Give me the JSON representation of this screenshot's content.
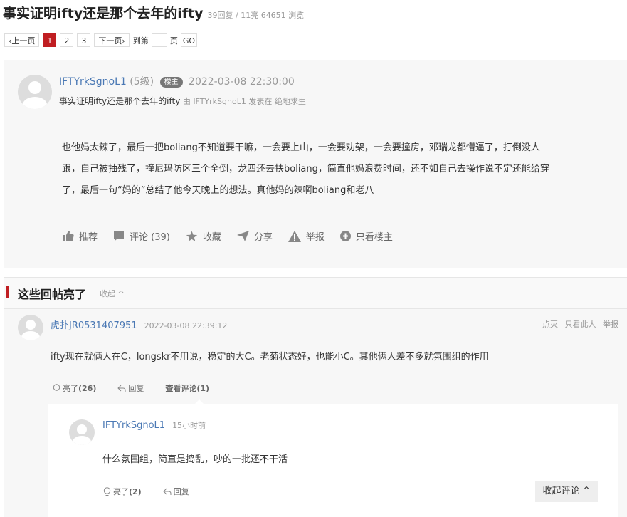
{
  "thread": {
    "title": "事实证明ifty还是那个去年的ifty",
    "stats": "39回复 / 11亮 64651 浏览"
  },
  "pager": {
    "prev": "‹上一页",
    "pages": [
      "1",
      "2",
      "3"
    ],
    "next": "下一页›",
    "goto_prefix": "到第",
    "goto_suffix": "页",
    "go": "GO"
  },
  "post": {
    "username": "IFTYrkSgnoL1",
    "level": "(5级)",
    "badge": "楼主",
    "time": "2022-03-08 22:30:00",
    "subject": "事实证明ifty还是那个去年的ifty",
    "by_label": "由",
    "by_user": "IFTYrkSgnoL1",
    "posted_in_label": "发表在",
    "forum": "绝地求生",
    "content_lines": [
      "也他妈太辣了，最后一把boliang不知道要干嘛，一会要上山，一会要劝架，一会要撞房，邓瑞龙都懵逼了，打倒没人",
      "跟，自己被抽残了，撞尼玛防区三个全倒，龙四还去扶boliang，简直他妈浪费时间，还不如自己去操作说不定还能给穿",
      "了，最后一句“妈的”总结了他今天晚上的想法。真他妈的辣啊boliang和老八"
    ],
    "actions": {
      "recommend": "推荐",
      "comment": "评论 (39)",
      "favorite": "收藏",
      "share": "分享",
      "report": "举报",
      "only_op": "只看楼主"
    }
  },
  "highlights": {
    "title": "这些回帖亮了",
    "collapse": "收起 ^",
    "reply": {
      "username": "虎扑JR0531407951",
      "time": "2022-03-08 22:39:12",
      "links": [
        "点灭",
        "只看此人",
        "举报"
      ],
      "text": "ifty现在就俩人在C，longskr不用说，稳定的大C。老菊状态好，也能小C。其他俩人差不多就氛围组的作用",
      "light": "亮了",
      "light_count": "(26)",
      "reply_label": "回复",
      "view_comments": "查看评论(1)"
    },
    "sub_reply": {
      "username": "IFTYrkSgnoL1",
      "time": "15小时前",
      "text": "什么氛围组，简直是捣乱，吵的一批还不干活",
      "light": "亮了",
      "light_count": "(2)",
      "reply_label": "回复",
      "collapse_comments": "收起评论 ^"
    }
  },
  "colors": {
    "accent_red": "#c01e22",
    "link_blue": "#4a78b4",
    "panel_bg": "#f7f7f7"
  }
}
